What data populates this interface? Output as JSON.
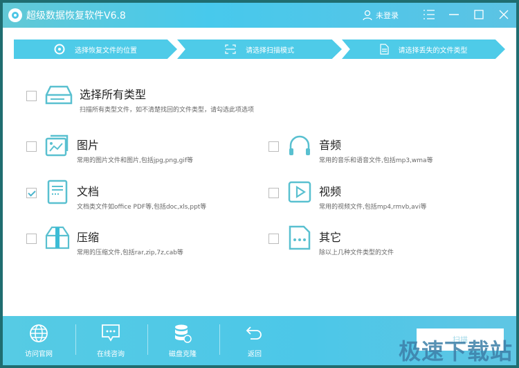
{
  "app": {
    "title": "超级数据恢复软件V6.8",
    "user_label": "未登录"
  },
  "steps": [
    {
      "label": "选择恢复文件的位置",
      "icon": "disc-icon"
    },
    {
      "label": "请选择扫描模式",
      "icon": "scan-icon"
    },
    {
      "label": "请选择丢失的文件类型",
      "icon": "document-icon"
    }
  ],
  "options": {
    "all": {
      "title": "选择所有类型",
      "desc": "扫描所有类型文件，如不清楚找回的文件类型，请勾选此项选项",
      "checked": false
    },
    "image": {
      "title": "图片",
      "desc": "常用的图片文件和图片,包括jpg,png,gif等",
      "checked": false
    },
    "audio": {
      "title": "音频",
      "desc": "常用的音乐和语音文件,包括mp3,wma等",
      "checked": false
    },
    "doc": {
      "title": "文档",
      "desc": "文档类文件如office PDF等,包括doc,xls,ppt等",
      "checked": true
    },
    "video": {
      "title": "视频",
      "desc": "常用的视频文件,包括mp4,rmvb,avi等",
      "checked": false
    },
    "zip": {
      "title": "压缩",
      "desc": "常用的压缩文件,包括rar,zip,7z,cab等",
      "checked": false
    },
    "other": {
      "title": "其它",
      "desc": "除以上几种文件类型的文件",
      "checked": false
    }
  },
  "footer": {
    "website": "访问官网",
    "consult": "在线咨询",
    "clone": "磁盘克隆",
    "back": "返回",
    "scan": "扫描"
  },
  "watermark": "极速下载站",
  "colors": {
    "accent": "#4ecbe8",
    "border": "#1f6d70"
  }
}
